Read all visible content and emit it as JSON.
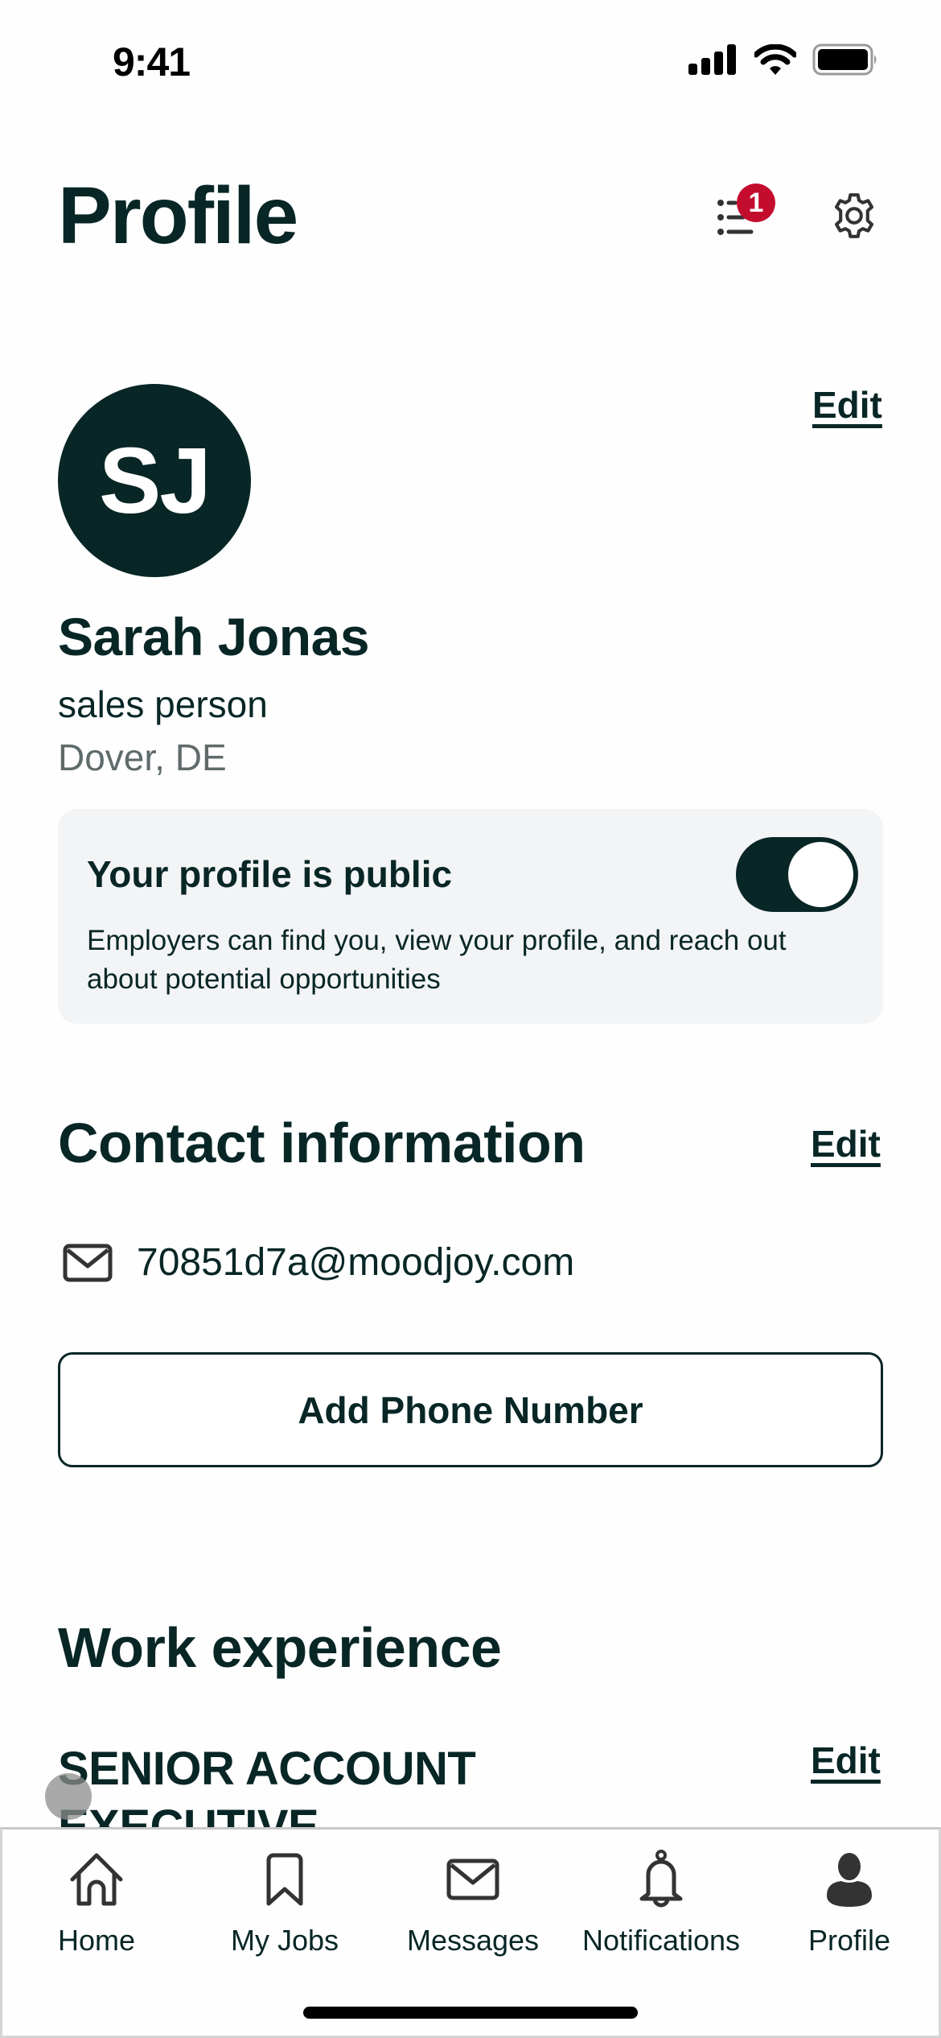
{
  "status_bar": {
    "time": "9:41",
    "icons": [
      "cellular-signal-icon",
      "wifi-icon",
      "battery-icon"
    ]
  },
  "header": {
    "title": "Profile",
    "checklist_badge_count": "1",
    "checklist_icon": "checklist-icon",
    "settings_icon": "gear-icon"
  },
  "profile": {
    "initials": "SJ",
    "name": "Sarah Jonas",
    "headline": "sales person",
    "location": "Dover, DE",
    "edit_label": "Edit"
  },
  "visibility": {
    "title": "Your profile is public",
    "description": "Employers can find you, view your profile, and reach out about potential opportunities",
    "is_public": true
  },
  "contact": {
    "title": "Contact information",
    "edit_label": "Edit",
    "email": "70851d7a@moodjoy.com",
    "add_phone_label": "Add Phone Number"
  },
  "work_experience": {
    "title": "Work experience",
    "items": [
      {
        "job_title": "SENIOR ACCOUNT EXECUTIVE",
        "edit_label": "Edit"
      }
    ]
  },
  "tabbar": {
    "items": [
      {
        "label": "Home",
        "icon": "home-icon",
        "active": false
      },
      {
        "label": "My Jobs",
        "icon": "bookmark-icon",
        "active": false
      },
      {
        "label": "Messages",
        "icon": "envelope-icon",
        "active": false
      },
      {
        "label": "Notifications",
        "icon": "bell-icon",
        "active": false
      },
      {
        "label": "Profile",
        "icon": "person-icon",
        "active": true
      }
    ]
  },
  "colors": {
    "primary": "#082626",
    "badge": "#c40d2e",
    "muted_text": "#5f6b6b",
    "card_bg": "#f3f4f6"
  }
}
